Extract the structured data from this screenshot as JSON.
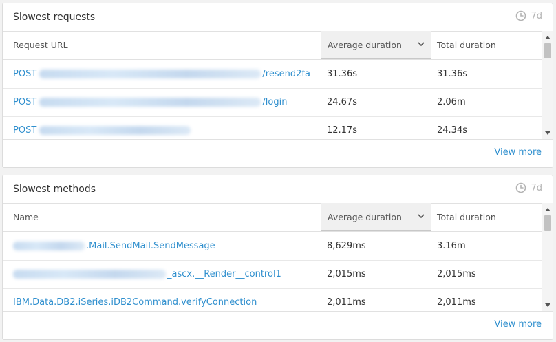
{
  "widgets": [
    {
      "title": "Slowest requests",
      "timeframe": "7d",
      "columns": {
        "name": "Request URL",
        "avg": "Average duration",
        "total": "Total duration"
      },
      "rows": [
        {
          "prefix": "POST",
          "suffix": "/resend2fa",
          "avg": "31.36s",
          "total": "31.36s"
        },
        {
          "prefix": "POST",
          "suffix": "/login",
          "avg": "24.67s",
          "total": "2.06m"
        },
        {
          "prefix": "POST",
          "suffix": "",
          "avg": "12.17s",
          "total": "24.34s"
        }
      ],
      "view_more": "View more"
    },
    {
      "title": "Slowest methods",
      "timeframe": "7d",
      "columns": {
        "name": "Name",
        "avg": "Average duration",
        "total": "Total duration"
      },
      "rows": [
        {
          "prefix": "",
          "suffix": ".Mail.SendMail.SendMessage",
          "avg": "8,629ms",
          "total": "3.16m"
        },
        {
          "prefix": "",
          "suffix": "_ascx.__Render__control1",
          "avg": "2,015ms",
          "total": "2,015ms"
        },
        {
          "prefix": "",
          "suffix": "IBM.Data.DB2.iSeries.iDB2Command.verifyConnection",
          "avg": "2,011ms",
          "total": "2,011ms"
        }
      ],
      "view_more": "View more"
    }
  ],
  "colors": {
    "link": "#2f8fce",
    "muted": "#b3b3b3"
  },
  "icons": {
    "timeframe": "clock-icon",
    "sort": "chevron-down-icon"
  }
}
